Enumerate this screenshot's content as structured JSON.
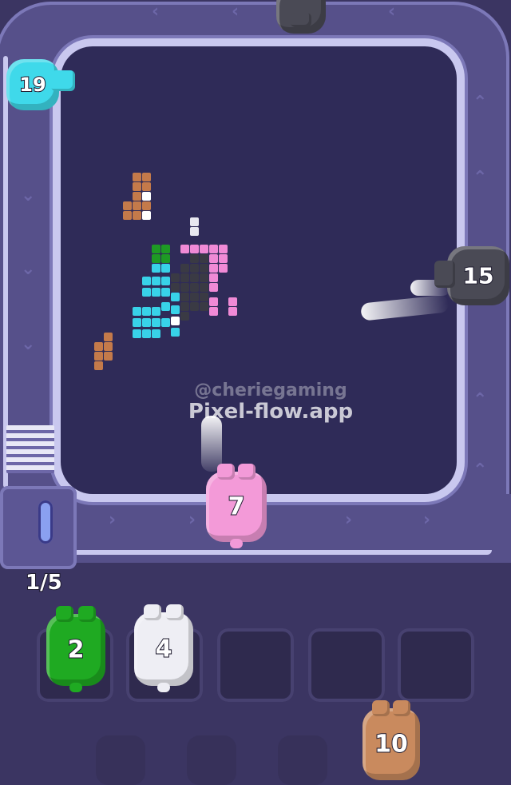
{
  "colors": {
    "background": "#3b3562",
    "track": "#56508a",
    "rail": "#c9c8ef",
    "board": "#2f2b58",
    "pig_cyan": "#3fd9ea",
    "pig_gray": "#4a4a55",
    "pig_pink": "#f39ad8",
    "pig_green": "#1faa22",
    "pig_white": "#eeeef4",
    "pig_brown": "#c98a5e"
  },
  "watermark": {
    "handle": "@cheriegaming",
    "site": "Pixel-flow.app"
  },
  "track_pigs": [
    {
      "id": "cyan",
      "ammo": "19",
      "color": "cyan"
    },
    {
      "id": "gray-top",
      "ammo": "",
      "color": "gray"
    },
    {
      "id": "gray-right",
      "ammo": "15",
      "color": "gray"
    },
    {
      "id": "pink",
      "ammo": "7",
      "color": "pink"
    }
  ],
  "queue_counter": "1/5",
  "slots": [
    {
      "ammo": "2",
      "color": "green"
    },
    {
      "ammo": "4",
      "color": "white"
    },
    {
      "ammo": "",
      "color": "empty"
    },
    {
      "ammo": "",
      "color": "empty"
    },
    {
      "ammo": "",
      "color": "empty"
    }
  ],
  "incoming_pig": {
    "ammo": "10",
    "color": "brown"
  }
}
